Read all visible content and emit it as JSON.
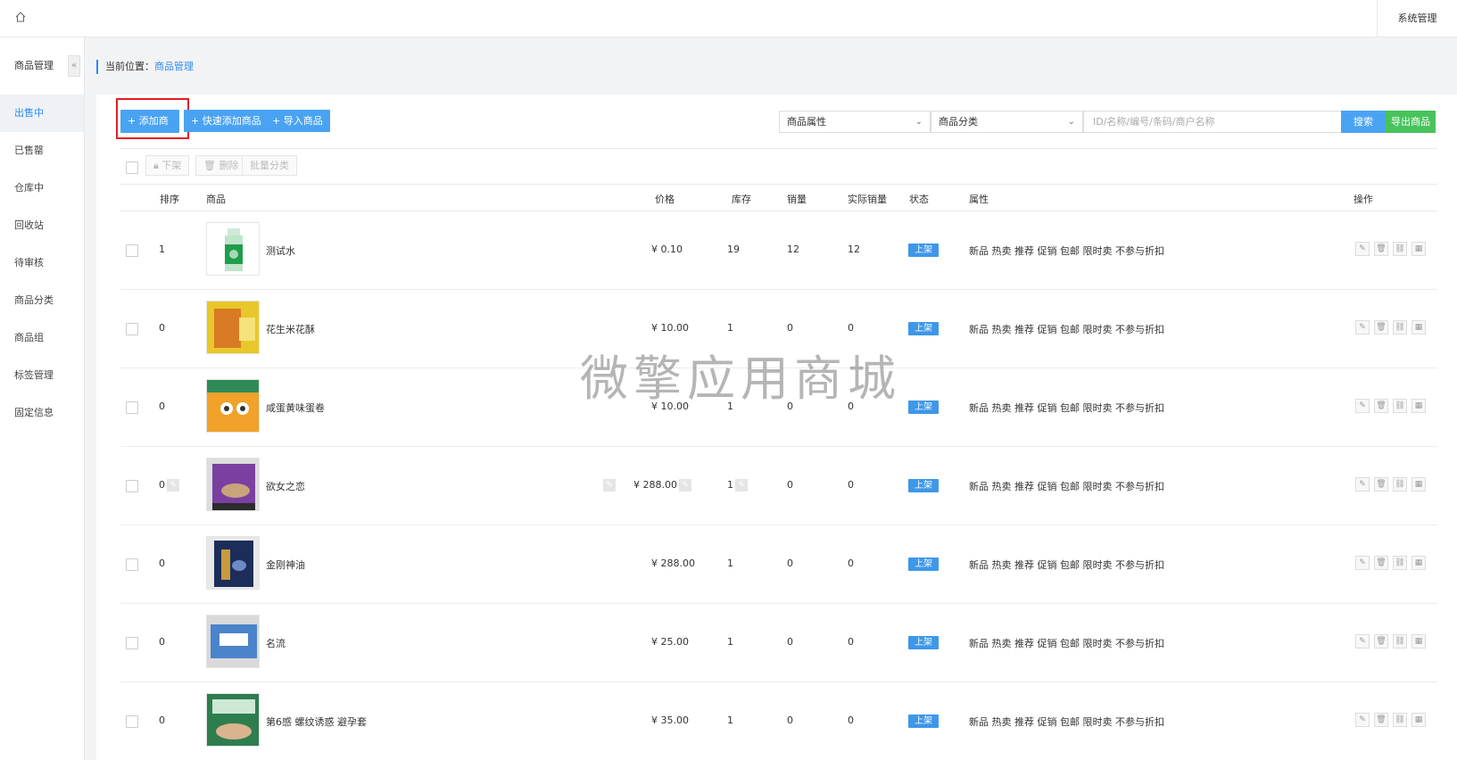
{
  "topbar": {
    "system_label": "系统管理",
    "home_icon": "home-icon"
  },
  "sidebar": {
    "title": "商品管理",
    "collapse_glyph": "«",
    "items": [
      {
        "label": "出售中",
        "active": true
      },
      {
        "label": "已售罄"
      },
      {
        "label": "仓库中"
      },
      {
        "label": "回收站"
      },
      {
        "label": "待审核"
      },
      {
        "label": "商品分类"
      },
      {
        "label": "商品组"
      },
      {
        "label": "标签管理"
      },
      {
        "label": "固定信息"
      }
    ]
  },
  "breadcrumb": {
    "prefix": "当前位置：",
    "current": "商品管理"
  },
  "toolbar": {
    "add_label": "+ 添加商品",
    "quick_add_label": "+ 快速添加商品",
    "import_label": "+ 导入商品",
    "attr_select": "商品属性",
    "category_select": "商品分类",
    "search_placeholder": "ID/名称/编号/条码/商户名称",
    "search_label": "搜索",
    "export_label": "导出商品"
  },
  "bulk": {
    "offshelf": "下架",
    "delete": "删除",
    "batch_category": "批量分类"
  },
  "columns": {
    "sort": "排序",
    "product": "商品",
    "price": "价格",
    "stock": "库存",
    "sales": "销量",
    "real_sales": "实际销量",
    "status": "状态",
    "attrs": "属性",
    "ops": "操作"
  },
  "rows": [
    {
      "sort": "1",
      "name": "测试水",
      "price": "¥ 0.10",
      "stock": "19",
      "sales": "12",
      "real_sales": "12",
      "status": "上架",
      "attrs": "新品 热卖 推荐 促销 包邮 限时卖 不参与折扣"
    },
    {
      "sort": "0",
      "name": "花生米花酥",
      "price": "¥ 10.00",
      "stock": "1",
      "sales": "0",
      "real_sales": "0",
      "status": "上架",
      "attrs": "新品 热卖 推荐 促销 包邮 限时卖 不参与折扣"
    },
    {
      "sort": "0",
      "name": "咸蛋黄味蛋卷",
      "price": "¥ 10.00",
      "stock": "1",
      "sales": "0",
      "real_sales": "0",
      "status": "上架",
      "attrs": "新品 热卖 推荐 促销 包邮 限时卖 不参与折扣"
    },
    {
      "sort": "0",
      "name": "欲女之恋",
      "price": "¥ 288.00",
      "stock": "1",
      "sales": "0",
      "real_sales": "0",
      "status": "上架",
      "attrs": "新品 热卖 推荐 促销 包邮 限时卖 不参与折扣",
      "editing": true
    },
    {
      "sort": "0",
      "name": "金刚神油",
      "price": "¥ 288.00",
      "stock": "1",
      "sales": "0",
      "real_sales": "0",
      "status": "上架",
      "attrs": "新品 热卖 推荐 促销 包邮 限时卖 不参与折扣"
    },
    {
      "sort": "0",
      "name": "名流",
      "price": "¥ 25.00",
      "stock": "1",
      "sales": "0",
      "real_sales": "0",
      "status": "上架",
      "attrs": "新品 热卖 推荐 促销 包邮 限时卖 不参与折扣"
    },
    {
      "sort": "0",
      "name": "第6感 螺纹诱惑 避孕套",
      "price": "¥ 35.00",
      "stock": "1",
      "sales": "0",
      "real_sales": "0",
      "status": "上架",
      "attrs": "新品 热卖 推荐 促销 包邮 限时卖 不参与折扣"
    }
  ],
  "watermark": "微擎应用商城",
  "colors": {
    "accent": "#4aa3f2",
    "export": "#48c35c",
    "highlight": "#e51c23",
    "status": "#3e97e8"
  }
}
